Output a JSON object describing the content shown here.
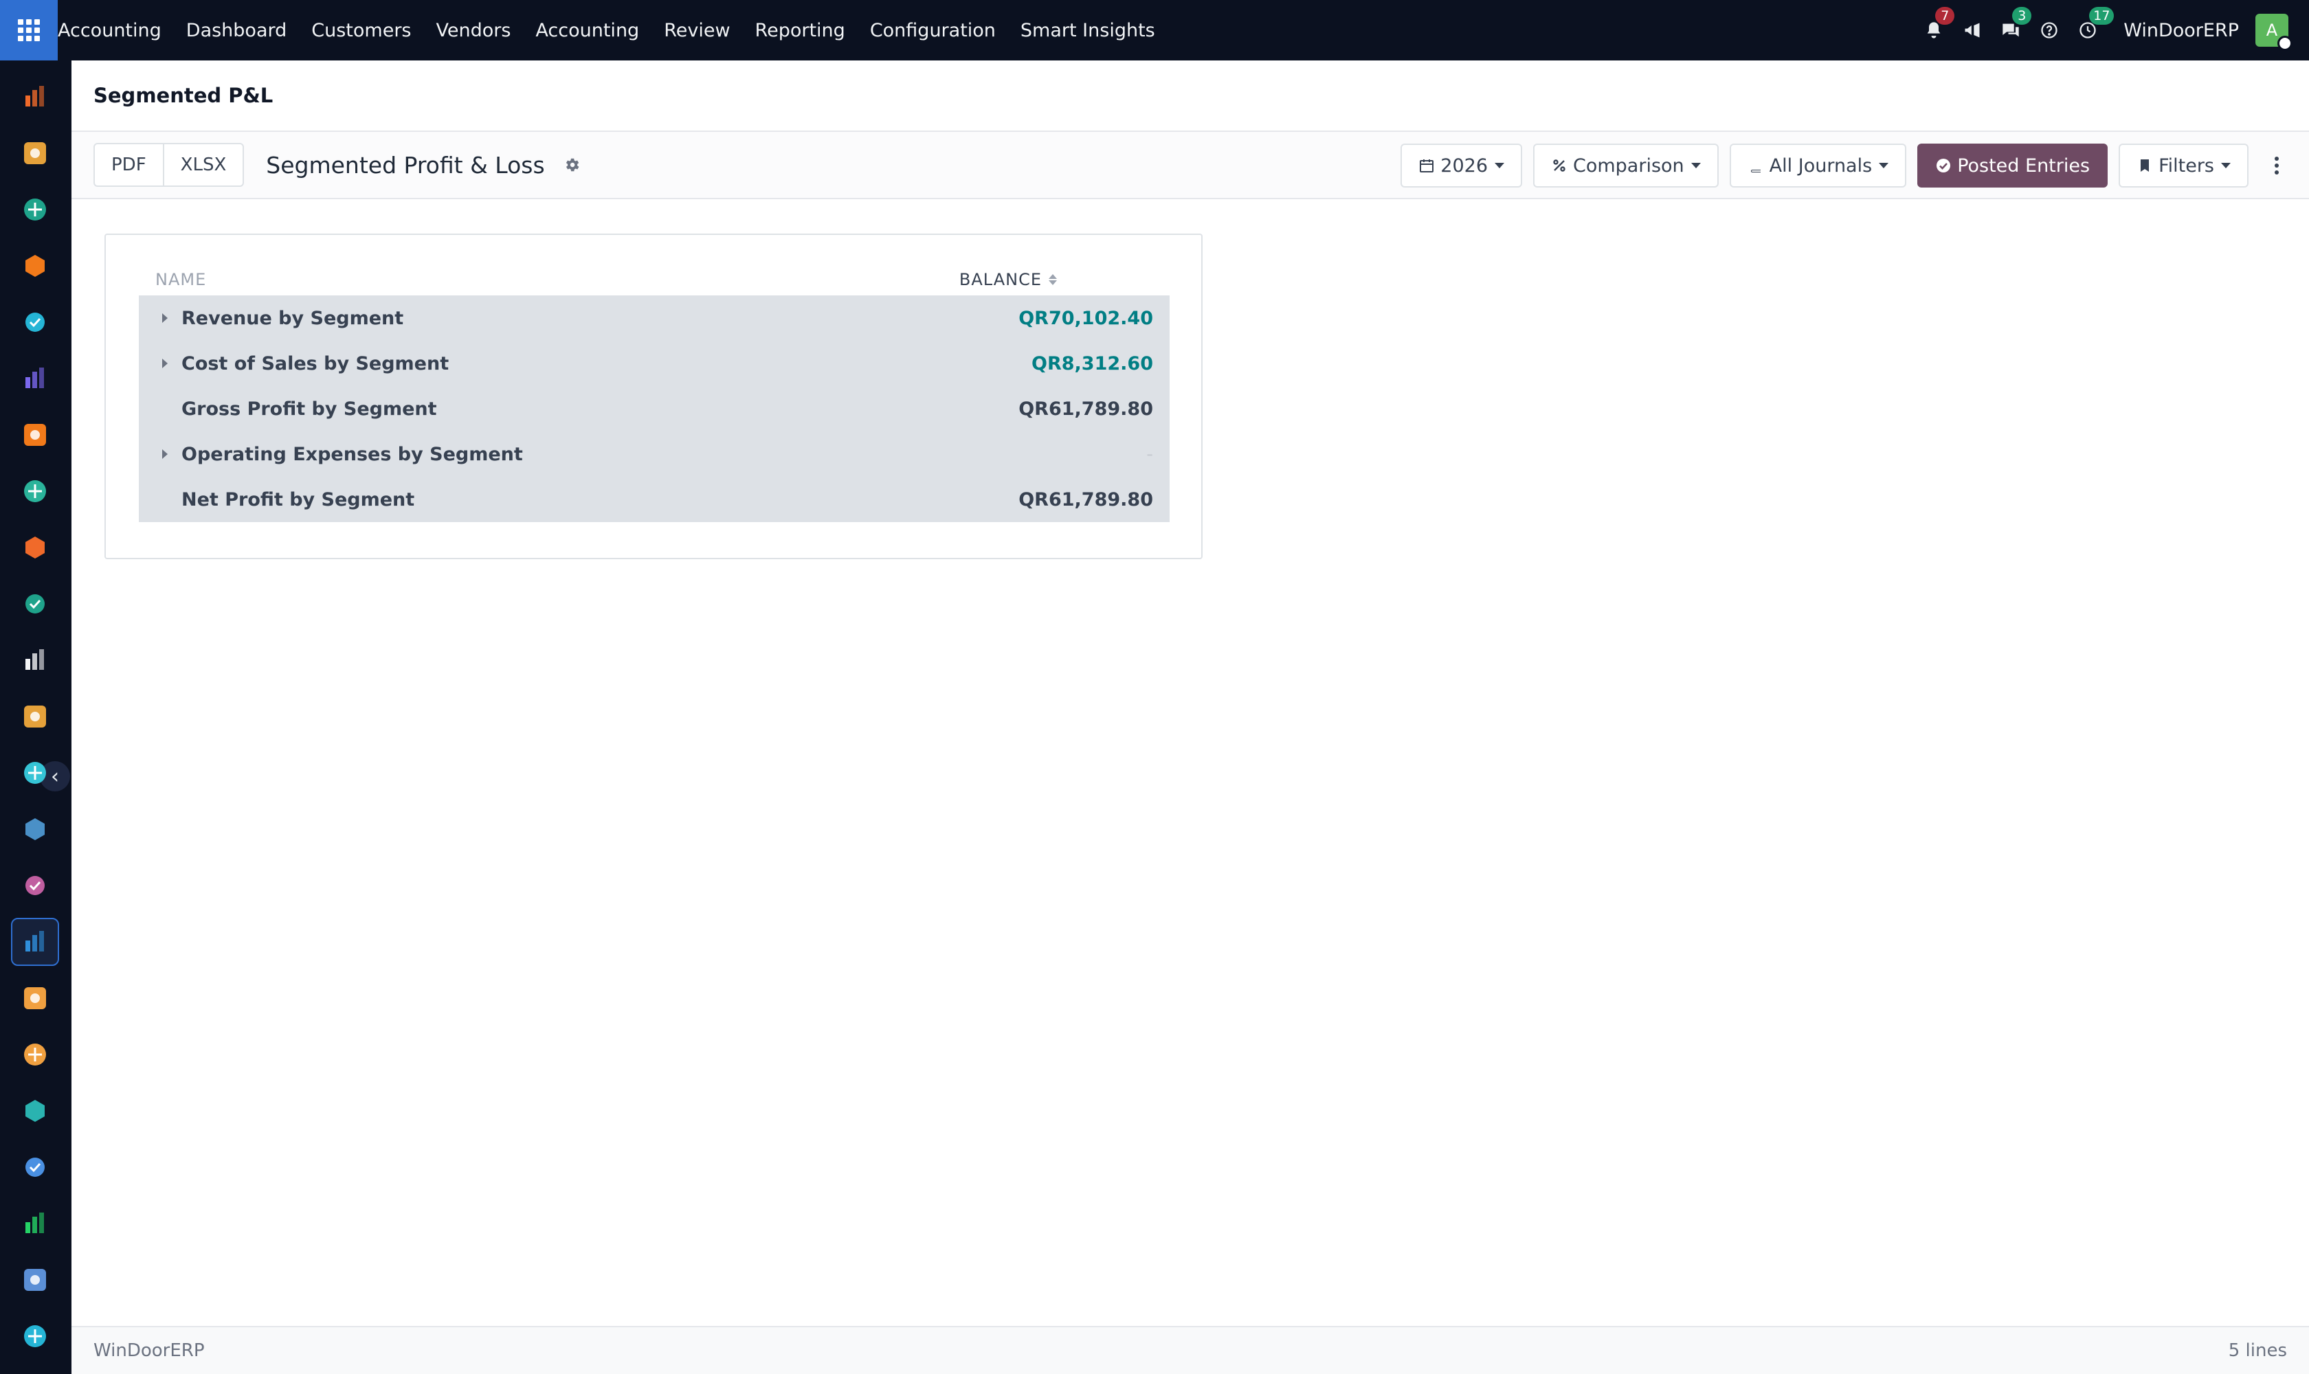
{
  "navbar": {
    "brand": "Accounting",
    "menu": [
      {
        "label": "Dashboard"
      },
      {
        "label": "Customers"
      },
      {
        "label": "Vendors"
      },
      {
        "label": "Accounting"
      },
      {
        "label": "Review"
      },
      {
        "label": "Reporting"
      },
      {
        "label": "Configuration"
      },
      {
        "label": "Smart Insights"
      }
    ],
    "tray": {
      "notifications_count": "7",
      "messages_count": "3",
      "activities_count": "17",
      "company": "WinDoorERP",
      "avatar_letter": "A"
    }
  },
  "sidebar": {
    "apps": [
      {
        "icon": "reporting-icon",
        "color": "#f06a2a"
      },
      {
        "icon": "discuss-icon",
        "color": "#e5a13a"
      },
      {
        "icon": "contacts-icon",
        "color": "#1fa38b"
      },
      {
        "icon": "chat-icon",
        "color": "#f27a1a"
      },
      {
        "icon": "website-icon",
        "color": "#25b5d6"
      },
      {
        "icon": "email-marketing-icon",
        "color": "#7b68ee"
      },
      {
        "icon": "livechat-icon",
        "color": "#f27a1a"
      },
      {
        "icon": "sales-icon",
        "color": "#2ab39a"
      },
      {
        "icon": "dashboard-icon",
        "color": "#f06a2a"
      },
      {
        "icon": "employees-icon",
        "color": "#1fa38b"
      },
      {
        "icon": "inventory-icon",
        "color": "#f3f4f6"
      },
      {
        "icon": "marketing-icon",
        "color": "#e5a13a"
      },
      {
        "icon": "project-icon",
        "color": "#35c4d6"
      },
      {
        "icon": "knowledge-icon",
        "color": "#4a90c7"
      },
      {
        "icon": "manufacturing-icon",
        "color": "#c05ea0"
      },
      {
        "icon": "invoicing-icon",
        "color": "#2f8fdc"
      },
      {
        "icon": "team-icon",
        "color": "#f0a040"
      },
      {
        "icon": "calendar-icon",
        "color": "#f0a040"
      },
      {
        "icon": "sign-icon",
        "color": "#2ab3b0"
      },
      {
        "icon": "apps-grid-icon",
        "color": "#4a90e2"
      },
      {
        "icon": "whatsapp-icon",
        "color": "#25d366"
      },
      {
        "icon": "timesheet-icon",
        "color": "#5b8fd6"
      },
      {
        "icon": "website-builder-icon",
        "color": "#25b5d6"
      }
    ]
  },
  "page": {
    "title": "Segmented P&L"
  },
  "controls": {
    "pdf_label": "PDF",
    "xlsx_label": "XLSX",
    "report_title": "Segmented Profit & Loss",
    "year_label": "2026",
    "comparison_label": "Comparison",
    "journals_label": "All Journals",
    "posted_label": "Posted Entries",
    "filters_label": "Filters"
  },
  "report": {
    "col_name": "NAME",
    "col_balance": "BALANCE",
    "rows": [
      {
        "label": "Revenue by Segment",
        "value": "QR70,102.40",
        "expandable": true,
        "style": "link"
      },
      {
        "label": "Cost of Sales by Segment",
        "value": "QR8,312.60",
        "expandable": true,
        "style": "link"
      },
      {
        "label": "Gross Profit by Segment",
        "value": "QR61,789.80",
        "expandable": false,
        "style": "plain"
      },
      {
        "label": "Operating Expenses by Segment",
        "value": "-",
        "expandable": true,
        "style": "muted"
      },
      {
        "label": "Net Profit by Segment",
        "value": "QR61,789.80",
        "expandable": false,
        "style": "plain"
      }
    ]
  },
  "footer": {
    "company": "WinDoorERP",
    "lines_count": "5 lines"
  }
}
